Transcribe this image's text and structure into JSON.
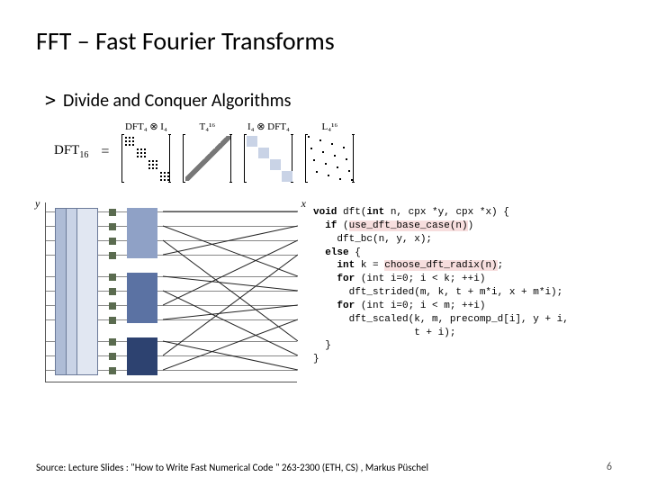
{
  "title": "FFT – Fast Fourier Transforms",
  "bullet": "Divide and Conquer Algorithms",
  "chevron": ">",
  "equation": {
    "lhs": "DFT",
    "lhs_sub": "16",
    "eq": "=",
    "factors": [
      {
        "label": "DFT₄ ⊗ I₄"
      },
      {
        "label": "T₄¹⁶"
      },
      {
        "label": "I₄ ⊗ DFT₄"
      },
      {
        "label": "L₄¹⁶"
      }
    ]
  },
  "diagram": {
    "ylabel": "y",
    "xlabel": "x"
  },
  "code": {
    "l1a": "void",
    "l1b": " dft(",
    "l1c": "int",
    "l1d": " n, cpx *y, cpx *x) {",
    "l2a": "  if",
    "l2b": " (",
    "l2hl": "use_dft_base_case(n)",
    "l2c": ")",
    "l3": "    dft_bc(n, y, x);",
    "l4a": "  else",
    "l4b": " {",
    "l5a": "    int",
    "l5b": " k = ",
    "l5hl": "choose_dft_radix(n)",
    "l5c": ";",
    "l6a": "    for",
    "l6b": " (int i=0; i < k; ++i)",
    "l7": "      dft_strided(m, k, t + m*i, x + m*i);",
    "l8a": "    for",
    "l8b": " (int i=0; i < m; ++i)",
    "l9": "      dft_scaled(k, m, precomp_d[i], y + i,",
    "l10": "                 t + i);",
    "l11": "  }",
    "l12": "}"
  },
  "source": "Source: Lecture Slides : \"How to Write Fast Numerical Code \" 263-2300 (ETH, CS) , Markus Püschel",
  "page": "6"
}
